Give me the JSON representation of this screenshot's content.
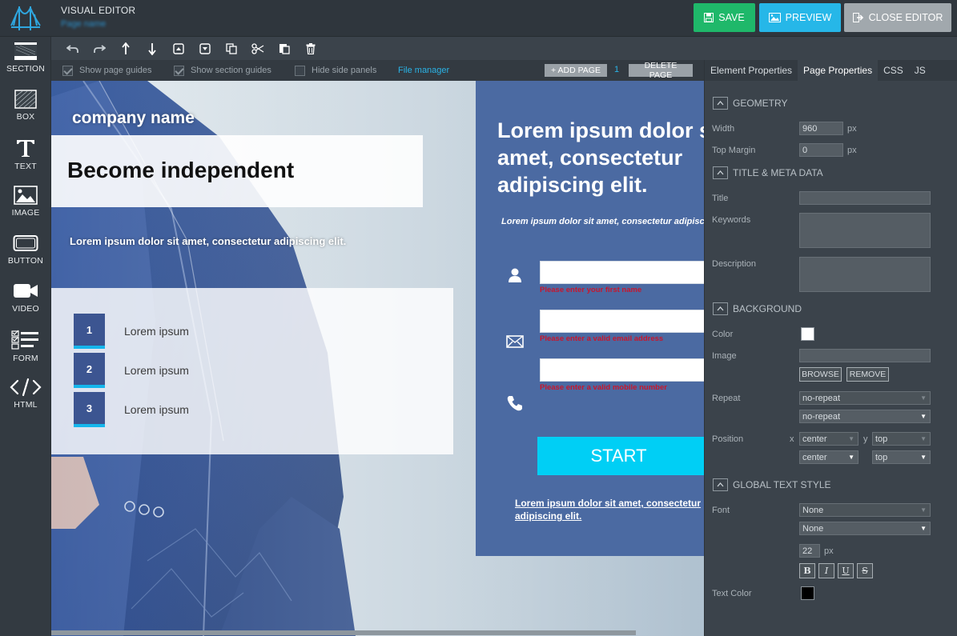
{
  "header": {
    "title": "VISUAL EDITOR",
    "subtitle": "Page name",
    "save_label": "SAVE",
    "preview_label": "PREVIEW",
    "close_label": "CLOSE EDITOR"
  },
  "sidebar": {
    "items": [
      {
        "label": "SECTION",
        "icon": "section-icon"
      },
      {
        "label": "BOX",
        "icon": "box-icon"
      },
      {
        "label": "TEXT",
        "icon": "text-icon"
      },
      {
        "label": "IMAGE",
        "icon": "image-icon"
      },
      {
        "label": "BUTTON",
        "icon": "button-icon"
      },
      {
        "label": "VIDEO",
        "icon": "video-icon"
      },
      {
        "label": "FORM",
        "icon": "form-icon"
      },
      {
        "label": "HTML",
        "icon": "html-icon"
      }
    ]
  },
  "toolbar": {
    "tools": [
      "undo-icon",
      "redo-icon",
      "move-up-icon",
      "move-down-icon",
      "collapse-icon",
      "expand-icon",
      "copy-icon",
      "cut-icon",
      "paste-icon",
      "delete-icon"
    ]
  },
  "options": {
    "show_page_guides": "Show page guides",
    "show_section_guides": "Show section guides",
    "hide_side_panels": "Hide side panels",
    "file_manager": "File manager",
    "add_page": "+ ADD PAGE",
    "page_number": "1",
    "delete_page": "DELETE PAGE"
  },
  "canvas": {
    "company_name": "company name",
    "headline": "Become independent",
    "subline": "Lorem ipsum dolor sit amet, consectetur adipiscing elit.",
    "list": [
      {
        "num": "1",
        "text": "Lorem ipsum"
      },
      {
        "num": "2",
        "text": "Lorem ipsum"
      },
      {
        "num": "3",
        "text": "Lorem ipsum"
      }
    ],
    "form": {
      "title_line1": "Lorem ipsum dolor sit",
      "title_line2": "amet, consectetur",
      "title_line3": "adipiscing elit.",
      "sub": "Lorem ipsum dolor sit amet, consectetur adipiscing elit.",
      "err_first_name": "Please enter your first name",
      "err_email": "Please enter a valid email address",
      "err_mobile": "Please enter a valid mobile number",
      "start_label": "START",
      "link_line1": "Lorem ipsum dolor sit amet, consectetur",
      "link_line2": "adipiscing elit."
    }
  },
  "panel": {
    "tabs": [
      "Element Properties",
      "Page Properties",
      "CSS",
      "JS"
    ],
    "active_tab": "Page Properties",
    "geometry": {
      "heading": "GEOMETRY",
      "width_label": "Width",
      "width_value": "960",
      "width_unit": "px",
      "top_margin_label": "Top Margin",
      "top_margin_value": "0",
      "top_margin_unit": "px"
    },
    "meta": {
      "heading": "TITLE & META DATA",
      "title_label": "Title",
      "keywords_label": "Keywords",
      "description_label": "Description"
    },
    "background": {
      "heading": "BACKGROUND",
      "color_label": "Color",
      "color_value": "#ffffff",
      "image_label": "Image",
      "browse_label": "BROWSE",
      "remove_label": "REMOVE",
      "repeat_label": "Repeat",
      "repeat_value_a": "no-repeat",
      "repeat_value_b": "no-repeat",
      "position_label": "Position",
      "x_label": "x",
      "y_label": "y",
      "pos_x_a": "center",
      "pos_y_a": "top",
      "pos_x_b": "center",
      "pos_y_b": "top"
    },
    "text_style": {
      "heading": "GLOBAL TEXT STYLE",
      "font_label": "Font",
      "font_value_a": "None",
      "font_value_b": "None",
      "size_value": "22",
      "size_unit": "px",
      "bold": "B",
      "italic": "I",
      "underline": "U",
      "strike": "S",
      "text_color_label": "Text Color",
      "text_color_value": "#000000"
    }
  },
  "colors": {
    "save": "#1fb86a",
    "preview": "#26b7e8",
    "close": "#a1a8ad",
    "accent": "#15b6ec",
    "form_panel": "#4b6aa2",
    "error": "#c8162d"
  }
}
